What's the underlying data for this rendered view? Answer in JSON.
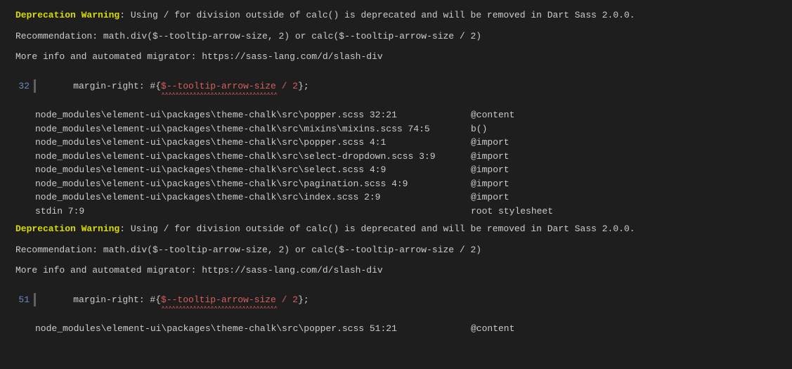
{
  "warnings": [
    {
      "label": "Deprecation Warning",
      "message": ": Using / for division outside of calc() is deprecated and will be removed in Dart Sass 2.0.0.",
      "recommendation": "Recommendation: math.div($--tooltip-arrow-size, 2) or calc($--tooltip-arrow-size / 2)",
      "moreinfo": "More info and automated migrator: https://sass-lang.com/d/slash-div",
      "line_number": "32",
      "code_prefix": "    margin-right: #{",
      "code_hl": "$--tooltip-arrow-size / 2",
      "code_suffix": "};",
      "squiggle": "^^^^^^^^^^^^^^^^^^^^^^^^^^^^^^^^^",
      "trace": [
        {
          "path": "node_modules\\element-ui\\packages\\theme-chalk\\src\\popper.scss 32:21",
          "ctx": "@content"
        },
        {
          "path": "node_modules\\element-ui\\packages\\theme-chalk\\src\\mixins\\mixins.scss 74:5",
          "ctx": "b()"
        },
        {
          "path": "node_modules\\element-ui\\packages\\theme-chalk\\src\\popper.scss 4:1",
          "ctx": "@import"
        },
        {
          "path": "node_modules\\element-ui\\packages\\theme-chalk\\src\\select-dropdown.scss 3:9",
          "ctx": "@import"
        },
        {
          "path": "node_modules\\element-ui\\packages\\theme-chalk\\src\\select.scss 4:9",
          "ctx": "@import"
        },
        {
          "path": "node_modules\\element-ui\\packages\\theme-chalk\\src\\pagination.scss 4:9",
          "ctx": "@import"
        },
        {
          "path": "node_modules\\element-ui\\packages\\theme-chalk\\src\\index.scss 2:9",
          "ctx": "@import"
        },
        {
          "path": "stdin 7:9",
          "ctx": "root stylesheet"
        }
      ]
    },
    {
      "label": "Deprecation Warning",
      "message": ": Using / for division outside of calc() is deprecated and will be removed in Dart Sass 2.0.0.",
      "recommendation": "Recommendation: math.div($--tooltip-arrow-size, 2) or calc($--tooltip-arrow-size / 2)",
      "moreinfo": "More info and automated migrator: https://sass-lang.com/d/slash-div",
      "line_number": "51",
      "code_prefix": "    margin-right: #{",
      "code_hl": "$--tooltip-arrow-size / 2",
      "code_suffix": "};",
      "squiggle": "^^^^^^^^^^^^^^^^^^^^^^^^^^^^^^^^^",
      "trace": [
        {
          "path": "node_modules\\element-ui\\packages\\theme-chalk\\src\\popper.scss 51:21",
          "ctx": "@content"
        }
      ]
    }
  ]
}
